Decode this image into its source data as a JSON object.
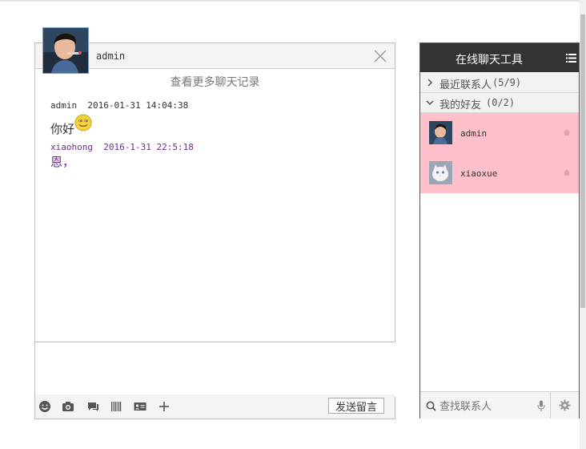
{
  "chat": {
    "contact_name": "admin",
    "more_history": "查看更多聊天记录",
    "messages": [
      {
        "sender": "admin",
        "time": "2016-01-31 14:04:38",
        "text": "你好",
        "color": "#333333"
      },
      {
        "sender": "xiaohong",
        "time": "2016-1-31 22:5:18",
        "text": "恩，",
        "color": "#6a2d8a"
      }
    ],
    "toolbar": {
      "icons": [
        "smiley-icon",
        "camera-icon",
        "chat-bubble-icon",
        "barcode-icon",
        "card-icon",
        "plus-icon"
      ],
      "send_label": "发送留言"
    }
  },
  "panel": {
    "title": "在线聊天工具",
    "groups": [
      {
        "label": "最近联系人",
        "count": "(5/9)",
        "expanded": false
      },
      {
        "label": "我的好友",
        "count": "(0/2)",
        "expanded": true
      }
    ],
    "friends": [
      {
        "name": "admin"
      },
      {
        "name": "xiaoxue"
      }
    ],
    "search_placeholder": "查找联系人"
  },
  "colors": {
    "panel_header": "#333333",
    "friend_highlight": "#ffc0cb",
    "reply_text": "#6a2d8a"
  }
}
